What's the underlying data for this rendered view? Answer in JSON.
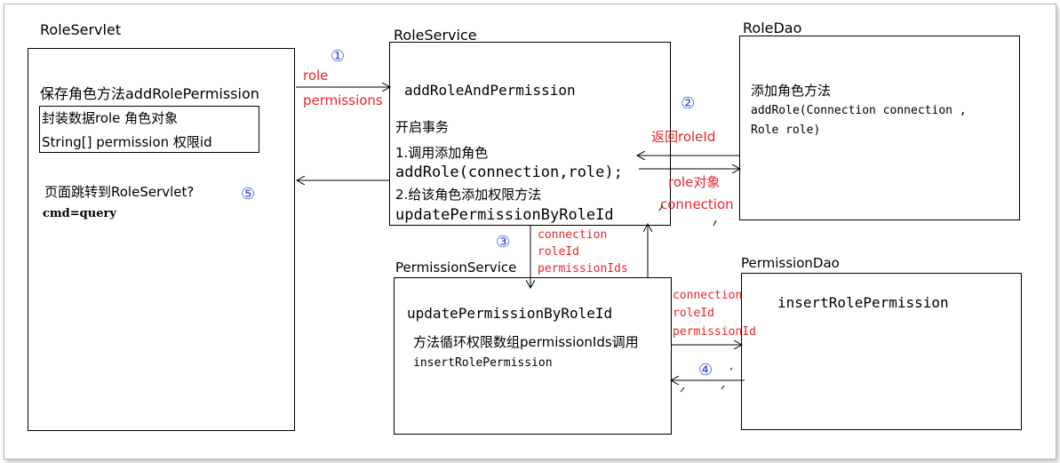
{
  "role_servlet": {
    "title": "RoleServlet",
    "method": "保存角色方法addRolePermission",
    "inner_line1": "封装数据role 角色对象",
    "inner_line2": "String[] permission  权限id",
    "redirect": "页面跳转到RoleServlet?",
    "cmd": "cmd=query"
  },
  "role_service": {
    "title": "RoleService",
    "method": "addRoleAndPermission",
    "tx": "开启事务",
    "step1": "1.调用添加角色",
    "add_role_call": "addRole(connection,role);",
    "step2": "2.给该角色添加权限方法",
    "update_call": "updatePermissionByRoleId"
  },
  "role_dao": {
    "title": "RoleDao",
    "desc": "添加角色方法",
    "sig1": "addRole(Connection connection ,",
    "sig2": "Role role)"
  },
  "permission_service": {
    "title": "PermissionService",
    "method": "updatePermissionByRoleId",
    "desc": "方法循环权限数组permissionIds调用",
    "call": "insertRolePermission"
  },
  "permission_dao": {
    "title": "PermissionDao",
    "method": "insertRolePermission"
  },
  "arrows": {
    "a1_role": "role",
    "a1_perms": "permissions",
    "a2_return": "返回roleId",
    "a2_roleobj": "role对象",
    "a2_conn": "connection",
    "a3_conn": "connection",
    "a3_roleid": "roleId",
    "a3_permids": "permissionIds",
    "a4_conn": "connection",
    "a4_roleid": "roleId",
    "a4_permid": "permissionId"
  },
  "steps": {
    "s1": "①",
    "s2": "②",
    "s3": "③",
    "s4": "④",
    "s5": "⑤"
  },
  "colors": {
    "annotation": "#e8262a",
    "step_marker": "#3a4fd8",
    "line": "#000000"
  }
}
